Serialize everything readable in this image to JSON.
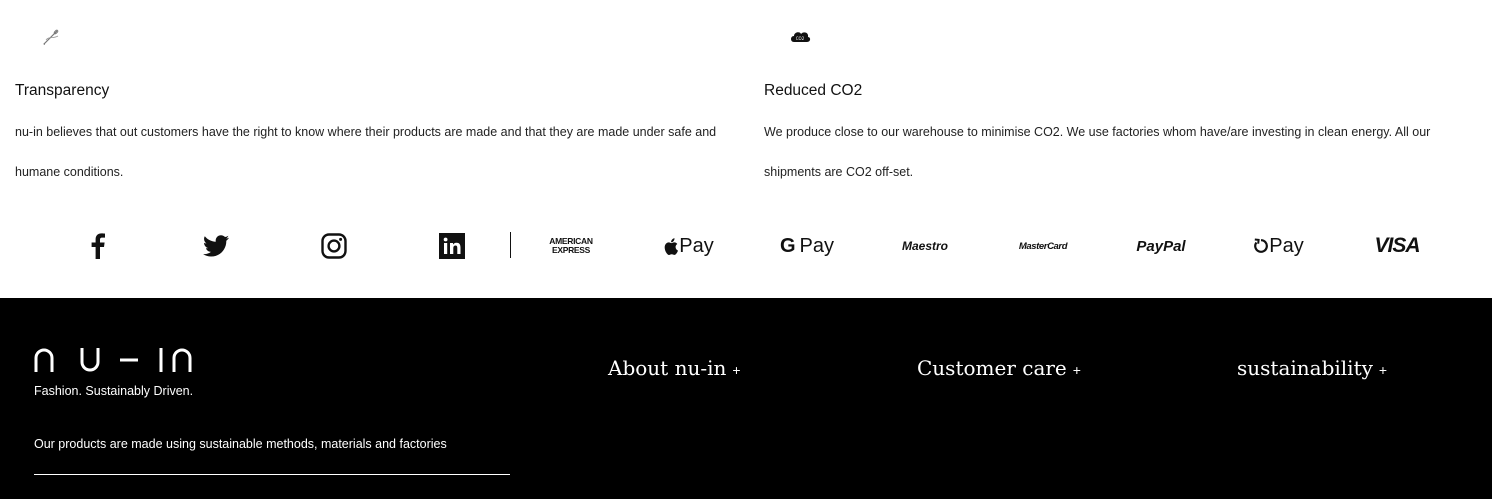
{
  "features": [
    {
      "icon": "needle-thread-icon",
      "title": "Transparency",
      "text": "nu-in believes that out customers have the right to know where their products are made and that they are made under safe and humane conditions."
    },
    {
      "icon": "co2-cloud-icon",
      "title": "Reduced CO2",
      "text": "We produce close to our warehouse to minimise CO2. We use factories whom have/are investing in clean energy. All our shipments are CO2 off-set."
    }
  ],
  "social": [
    "facebook-icon",
    "twitter-icon",
    "instagram-icon",
    "linkedin-icon"
  ],
  "payments": {
    "amex_line1": "AMERICAN",
    "amex_line2": "EXPRESS",
    "apple_pay": "Pay",
    "google_pay": "Pay",
    "maestro": "Maestro",
    "mastercard": "MasterCard",
    "paypal": "PayPal",
    "opay": "Pay",
    "visa": "VISA"
  },
  "footer": {
    "logo": "nu-in",
    "tagline": "Fashion. Sustainably Driven.",
    "description": "Our products are made using sustainable methods, materials and factories",
    "columns": [
      {
        "label": "About nu-in",
        "toggle": "+"
      },
      {
        "label": "Customer care",
        "toggle": "+"
      },
      {
        "label": "sustainability",
        "toggle": "+"
      }
    ]
  },
  "colors": {
    "footer_bg": "#000000",
    "text": "#111111",
    "page_bg": "#ffffff"
  }
}
